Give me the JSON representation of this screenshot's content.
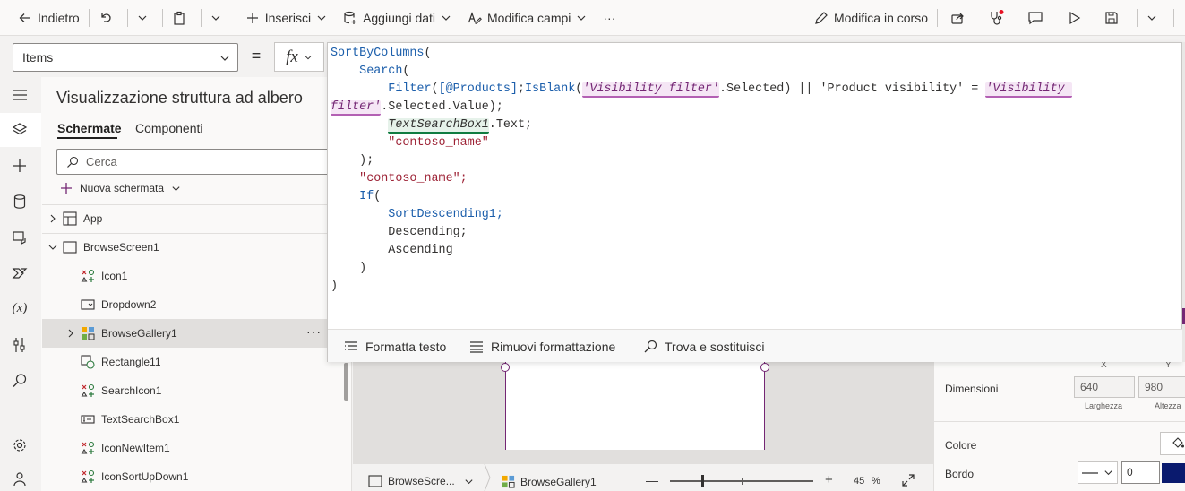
{
  "toolbar": {
    "back": "Indietro",
    "insert": "Inserisci",
    "add_data": "Aggiungi dati",
    "edit_fields": "Modifica campi",
    "more": "···",
    "edit_mode": "Modifica in corso"
  },
  "formula_bar": {
    "property": "Items",
    "equals": "=",
    "fx": "fx"
  },
  "tree": {
    "title": "Visualizzazione struttura ad albero",
    "tabs": [
      "Schermate",
      "Componenti"
    ],
    "search_placeholder": "Cerca",
    "new_screen": "Nuova schermata",
    "nodes": [
      "App",
      "BrowseScreen1",
      "Icon1",
      "Dropdown2",
      "BrowseGallery1",
      "Rectangle11",
      "SearchIcon1",
      "TextSearchBox1",
      "IconNewItem1",
      "IconSortUpDown1"
    ],
    "more": "···"
  },
  "editor": {
    "lines": [
      "SortByColumns(",
      "    Search(",
      "        Filter([@Products];IsBlank('Visibility filter'.Selected) || 'Product visibility' = 'Visibility",
      "filter'.Selected.Value);",
      "        TextSearchBox1.Text;",
      "        \"contoso_name\"",
      "    );",
      "    \"contoso_name\";",
      "    If(",
      "        SortDescending1;",
      "        Descending;",
      "        Ascending",
      "    )",
      ")"
    ],
    "tokens": {
      "sortbycolumns": "SortByColumns",
      "search": "Search",
      "filter": "Filter",
      "products": "[@Products]",
      "isblank": "IsBlank",
      "visfilter": "'Visibility filter'",
      "selected": ".Selected) || ",
      "prodvis": "'Product visibility'",
      "eq": " = ",
      "visfilter_a": "'Visibility ",
      "visfilter_b": "filter'",
      "selval": ".Selected.Value);",
      "textsearchbox": "TextSearchBox1",
      "text": ".Text;",
      "contoso1": "\"contoso_name\"",
      "close1": ");",
      "contoso2": "\"contoso_name\";",
      "if": "If",
      "sortdesc": "SortDescending1;",
      "desc": "Descending;",
      "asc": "Ascending",
      "close2": ")",
      "close3": ")"
    },
    "footer": {
      "format": "Formatta testo",
      "remove_format": "Rimuovi formattazione",
      "find_replace": "Trova e sostituisci"
    }
  },
  "status": {
    "crumb_screen": "BrowseScre...",
    "crumb_gallery": "BrowseGallery1",
    "zoom_minus": "—",
    "zoom_plus": "+",
    "zoom_value": "45",
    "zoom_unit": "%",
    "zoom_level": 0.45
  },
  "properties": {
    "x_label": "X",
    "y_label": "Y",
    "dimensions": "Dimensioni",
    "width": "640",
    "height": "980",
    "width_label": "Larghezza",
    "height_label": "Altezza",
    "color": "Colore",
    "border": "Bordo",
    "border_width": "0",
    "border_color": "#0a1a6e"
  },
  "colors": {
    "accent": "#742774",
    "function": "#1b5eab",
    "string": "#9d2235",
    "notification": "#e81123"
  }
}
